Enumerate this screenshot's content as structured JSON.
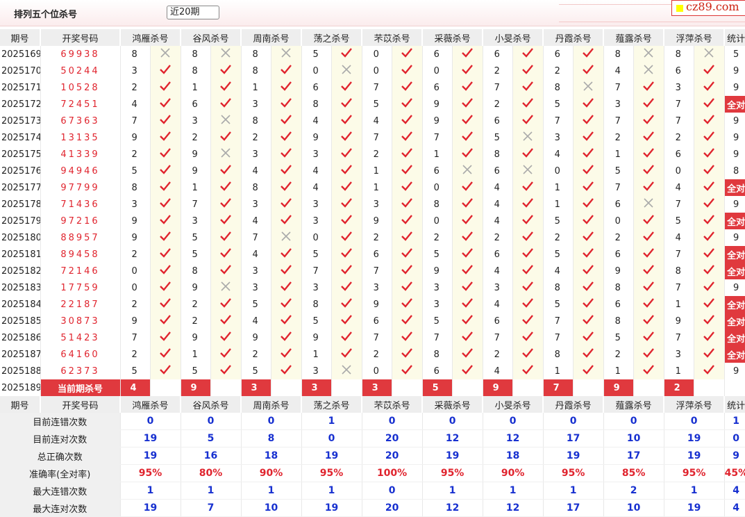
{
  "header": {
    "title": "排列五个位杀号",
    "select": "近20期",
    "logo": "cz89.com"
  },
  "columns": [
    "期号",
    "开奖号码",
    "鸿雁杀号",
    "谷风杀号",
    "周南杀号",
    "荡之杀号",
    "芣苡杀号",
    "采薇杀号",
    "小旻杀号",
    "丹霞杀号",
    "薤露杀号",
    "浮萍杀号",
    "统计"
  ],
  "colors": {
    "correct": "#e0242e",
    "wrong": "#aaaaaa",
    "accent": "#e0393e",
    "stat": "#1730d0"
  },
  "rows": [
    {
      "p": "2025169",
      "n": "69938",
      "k": [
        "8x",
        "8x",
        "8x",
        "5v",
        "0v",
        "6v",
        "6v",
        "6v",
        "8x",
        "8x"
      ],
      "s": "5"
    },
    {
      "p": "2025170",
      "n": "50244",
      "k": [
        "3v",
        "8v",
        "8v",
        "0x",
        "0v",
        "0v",
        "2v",
        "2v",
        "4x",
        "6v"
      ],
      "s": "9"
    },
    {
      "p": "2025171",
      "n": "10528",
      "k": [
        "2v",
        "1v",
        "1v",
        "6v",
        "7v",
        "6v",
        "7v",
        "8x",
        "7v",
        "3v"
      ],
      "s": "9"
    },
    {
      "p": "2025172",
      "n": "72451",
      "k": [
        "4v",
        "6v",
        "3v",
        "8v",
        "5v",
        "9v",
        "2v",
        "5v",
        "3v",
        "7v"
      ],
      "s": "全对"
    },
    {
      "p": "2025173",
      "n": "67363",
      "k": [
        "7v",
        "3x",
        "8v",
        "4v",
        "4v",
        "9v",
        "6v",
        "7v",
        "7v",
        "7v"
      ],
      "s": "9"
    },
    {
      "p": "2025174",
      "n": "13135",
      "k": [
        "9v",
        "2v",
        "2v",
        "9v",
        "7v",
        "7v",
        "5x",
        "3v",
        "2v",
        "2v"
      ],
      "s": "9"
    },
    {
      "p": "2025175",
      "n": "41339",
      "k": [
        "2v",
        "9x",
        "3v",
        "3v",
        "2v",
        "1v",
        "8v",
        "4v",
        "1v",
        "6v"
      ],
      "s": "9"
    },
    {
      "p": "2025176",
      "n": "94946",
      "k": [
        "5v",
        "9v",
        "4v",
        "4v",
        "1v",
        "6x",
        "6x",
        "0v",
        "5v",
        "0v"
      ],
      "s": "8"
    },
    {
      "p": "2025177",
      "n": "97799",
      "k": [
        "8v",
        "1v",
        "8v",
        "4v",
        "1v",
        "0v",
        "4v",
        "1v",
        "7v",
        "4v"
      ],
      "s": "全对"
    },
    {
      "p": "2025178",
      "n": "71436",
      "k": [
        "3v",
        "7v",
        "3v",
        "3v",
        "3v",
        "8v",
        "4v",
        "1v",
        "6x",
        "7v"
      ],
      "s": "9"
    },
    {
      "p": "2025179",
      "n": "97216",
      "k": [
        "9v",
        "3v",
        "4v",
        "3v",
        "9v",
        "0v",
        "4v",
        "5v",
        "0v",
        "5v"
      ],
      "s": "全对"
    },
    {
      "p": "2025180",
      "n": "88957",
      "k": [
        "9v",
        "5v",
        "7x",
        "0v",
        "2v",
        "2v",
        "2v",
        "2v",
        "2v",
        "4v"
      ],
      "s": "9"
    },
    {
      "p": "2025181",
      "n": "89458",
      "k": [
        "2v",
        "5v",
        "4v",
        "5v",
        "6v",
        "5v",
        "6v",
        "5v",
        "6v",
        "7v"
      ],
      "s": "全对"
    },
    {
      "p": "2025182",
      "n": "72146",
      "k": [
        "0v",
        "8v",
        "3v",
        "7v",
        "7v",
        "9v",
        "4v",
        "4v",
        "9v",
        "8v"
      ],
      "s": "全对"
    },
    {
      "p": "2025183",
      "n": "17759",
      "k": [
        "0v",
        "9x",
        "3v",
        "3v",
        "3v",
        "3v",
        "3v",
        "8v",
        "8v",
        "7v"
      ],
      "s": "9"
    },
    {
      "p": "2025184",
      "n": "22187",
      "k": [
        "2v",
        "2v",
        "5v",
        "8v",
        "9v",
        "3v",
        "4v",
        "5v",
        "6v",
        "1v"
      ],
      "s": "全对"
    },
    {
      "p": "2025185",
      "n": "30873",
      "k": [
        "9v",
        "2v",
        "4v",
        "5v",
        "6v",
        "5v",
        "6v",
        "7v",
        "8v",
        "9v"
      ],
      "s": "全对"
    },
    {
      "p": "2025186",
      "n": "51423",
      "k": [
        "7v",
        "9v",
        "9v",
        "9v",
        "7v",
        "7v",
        "7v",
        "7v",
        "5v",
        "7v"
      ],
      "s": "全对"
    },
    {
      "p": "2025187",
      "n": "64160",
      "k": [
        "2v",
        "1v",
        "2v",
        "1v",
        "2v",
        "8v",
        "2v",
        "8v",
        "2v",
        "3v"
      ],
      "s": "全对"
    },
    {
      "p": "2025188",
      "n": "62373",
      "k": [
        "5v",
        "5v",
        "5v",
        "3x",
        "0v",
        "6v",
        "4v",
        "1v",
        "1v",
        "1v"
      ],
      "s": "9"
    }
  ],
  "current": {
    "p": "2025189",
    "label": "当前期杀号",
    "k": [
      "4",
      "9",
      "3",
      "3",
      "3",
      "5",
      "9",
      "7",
      "9",
      "2"
    ]
  },
  "stats": [
    {
      "label": "目前连错次数",
      "v": [
        "0",
        "0",
        "0",
        "1",
        "0",
        "0",
        "0",
        "0",
        "0",
        "0",
        "1"
      ]
    },
    {
      "label": "目前连对次数",
      "v": [
        "19",
        "5",
        "8",
        "0",
        "20",
        "12",
        "12",
        "17",
        "10",
        "19",
        "0"
      ]
    },
    {
      "label": "总正确次数",
      "v": [
        "19",
        "16",
        "18",
        "19",
        "20",
        "19",
        "18",
        "19",
        "17",
        "19",
        "9"
      ]
    },
    {
      "label": "准确率(全对率)",
      "v": [
        "95%",
        "80%",
        "90%",
        "95%",
        "100%",
        "95%",
        "90%",
        "95%",
        "85%",
        "95%",
        "45%"
      ],
      "red": true
    },
    {
      "label": "最大连错次数",
      "v": [
        "1",
        "1",
        "1",
        "1",
        "0",
        "1",
        "1",
        "1",
        "2",
        "1",
        "4"
      ]
    },
    {
      "label": "最大连对次数",
      "v": [
        "19",
        "7",
        "10",
        "19",
        "20",
        "12",
        "12",
        "17",
        "10",
        "19",
        "4"
      ]
    }
  ]
}
